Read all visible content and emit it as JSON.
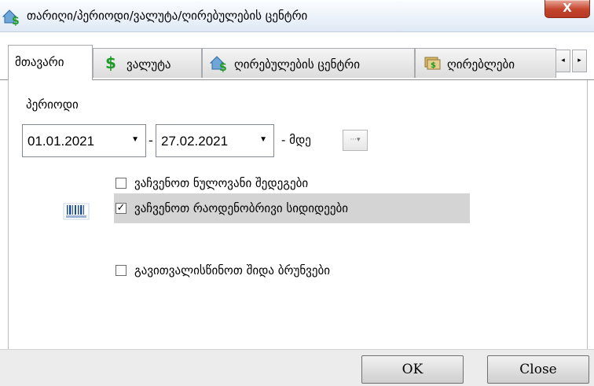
{
  "window": {
    "title": "თარიღი/პერიოდი/ვალუტა/ღირებულების ცენტრი",
    "close_label": "X"
  },
  "tabs": [
    {
      "label": "მთავარი",
      "icon": "none",
      "active": true
    },
    {
      "label": "ვალუტა",
      "icon": "dollar-icon"
    },
    {
      "label": "ღირებულების ცენტრი",
      "icon": "house-currency-icon"
    },
    {
      "label": "ღირებლები",
      "icon": "cash-icon"
    }
  ],
  "tab_scroll": {
    "left": "◂",
    "right": "▸"
  },
  "period": {
    "label": "პერიოდი",
    "from": "01.01.2021",
    "to": "27.02.2021",
    "separator": "-",
    "until_label": "- მდე",
    "more_label": "···▾"
  },
  "options": [
    {
      "label": "ვაჩვენოთ ნულოვანი შედეგები",
      "checked": false
    },
    {
      "label": "ვაჩვენოთ რაოდენობრივი სიდიდეები",
      "checked": true
    },
    {
      "label": "გავითვალისწინოთ შიდა ბრუნვები",
      "checked": false
    }
  ],
  "check_mark": "✓",
  "buttons": {
    "ok": "OK",
    "close": "Close"
  },
  "colors": {
    "accent_red": "#c4442c",
    "highlight": "#d4d4d4",
    "dollar_green": "#1f9a28"
  }
}
